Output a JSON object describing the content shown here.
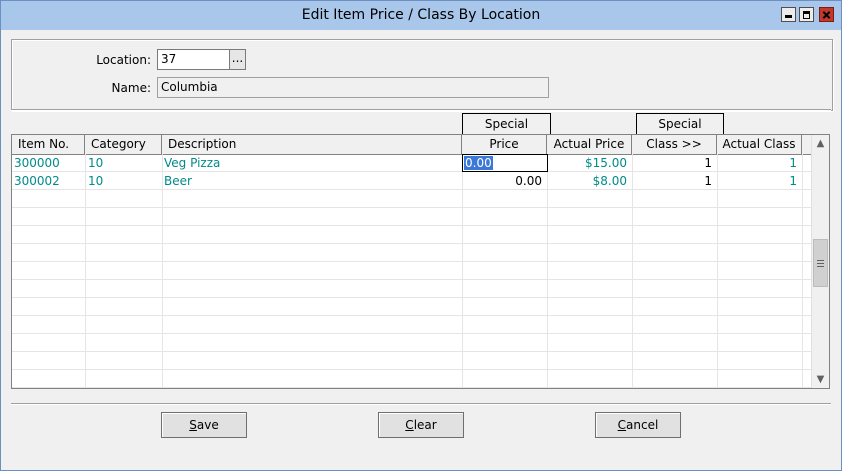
{
  "window": {
    "title": "Edit Item Price / Class By Location"
  },
  "controls": {
    "minimize": "minimize",
    "maximize": "maximize",
    "close": "close"
  },
  "location": {
    "label": "Location:",
    "value": "37",
    "browse_label": "..."
  },
  "name": {
    "label": "Name:",
    "value": "Columbia"
  },
  "special_headers": {
    "price": "Special",
    "class": "Special"
  },
  "grid": {
    "columns": [
      "Item No.",
      "Category",
      "Description",
      "Price",
      "Actual Price",
      "Class >>",
      "Actual Class"
    ],
    "rows": [
      {
        "item_no": "300000",
        "category": "10",
        "description": "Veg Pizza",
        "price": "0.00",
        "actual_price": "$15.00",
        "class": "1",
        "actual_class": "1"
      },
      {
        "item_no": "300002",
        "category": "10",
        "description": "Beer",
        "price": "0.00",
        "actual_price": "$8.00",
        "class": "1",
        "actual_class": "1"
      }
    ]
  },
  "buttons": {
    "save": {
      "accel": "S",
      "rest": "ave"
    },
    "clear": {
      "accel": "C",
      "rest": "lear"
    },
    "cancel": {
      "accel": "C",
      "rest": "ancel"
    }
  },
  "colors": {
    "teal_text": "#008b8b",
    "selection": "#3b78d8",
    "titlebar": "#a9c7ea"
  }
}
